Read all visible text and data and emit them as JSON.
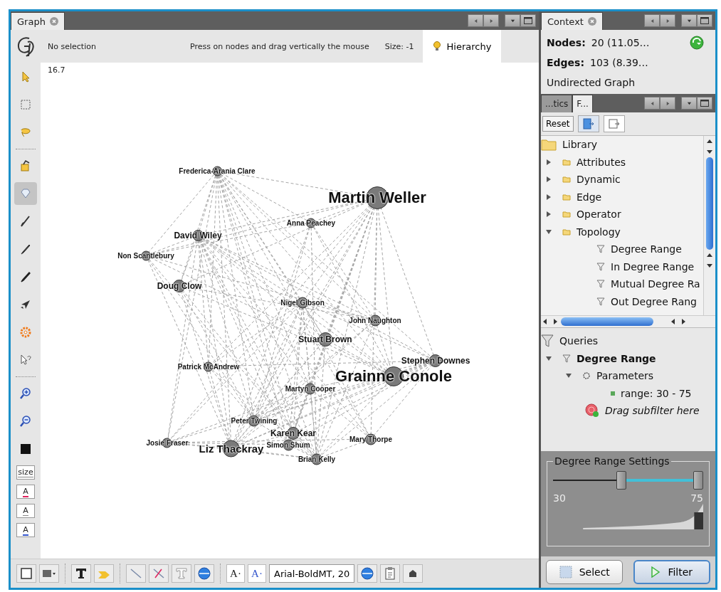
{
  "graph_tab": {
    "title": "Graph"
  },
  "graph_header": {
    "selection": "No selection",
    "hint": "Press on nodes and drag vertically the mouse",
    "size": "Size: -1",
    "hierarchy": "Hierarchy"
  },
  "scale": "16.7",
  "tools": [
    {
      "kind": "pointer",
      "selected": false
    },
    {
      "kind": "rect_select",
      "selected": false
    },
    {
      "kind": "lasso",
      "selected": false
    },
    {
      "kind": "separator"
    },
    {
      "kind": "painter",
      "selected": false
    },
    {
      "kind": "diamond",
      "selected": true
    },
    {
      "kind": "brush",
      "selected": false
    },
    {
      "kind": "pencil",
      "selected": false
    },
    {
      "kind": "pen",
      "selected": false
    },
    {
      "kind": "plane",
      "selected": false
    },
    {
      "kind": "gear",
      "selected": false
    },
    {
      "kind": "help",
      "selected": false
    },
    {
      "kind": "separator"
    },
    {
      "kind": "zoom_in",
      "selected": false
    },
    {
      "kind": "zoom_out",
      "selected": false
    },
    {
      "kind": "black_square",
      "selected": false
    },
    {
      "kind": "text",
      "label": "size",
      "selected": false
    },
    {
      "kind": "text",
      "label": "A",
      "color": "#e0245e",
      "selected": false
    },
    {
      "kind": "text",
      "label": "A",
      "selected": false
    },
    {
      "kind": "text",
      "label": "A",
      "color": "#3355cc",
      "selected": false
    }
  ],
  "nodes": [
    {
      "label": "Frederica-Arania Clare",
      "kind": "small"
    },
    {
      "label": "Martin Weller",
      "kind": "large"
    },
    {
      "label": "Anna Peachey",
      "kind": "small"
    },
    {
      "label": "David Wiley",
      "kind": "medium"
    },
    {
      "label": "Non Scantlebury",
      "kind": "small"
    },
    {
      "label": "Doug Clow",
      "kind": "medium"
    },
    {
      "label": "Nigel Gibson",
      "kind": "small"
    },
    {
      "label": "John Naughton",
      "kind": "small"
    },
    {
      "label": "Stuart Brown",
      "kind": "medium"
    },
    {
      "label": "Stephen Downes",
      "kind": "medium"
    },
    {
      "label": "Grainne Conole",
      "kind": "large"
    },
    {
      "label": "Patrick McAndrew",
      "kind": "small"
    },
    {
      "label": "Martyn Cooper",
      "kind": "small"
    },
    {
      "label": "Peter Twining",
      "kind": "small"
    },
    {
      "label": "Karen Kear",
      "kind": "medium"
    },
    {
      "label": "Josie Fraser",
      "kind": "small"
    },
    {
      "label": "Liz Thackray",
      "kind": "big"
    },
    {
      "label": "Simon Shum",
      "kind": "small"
    },
    {
      "label": "Mary Thorpe",
      "kind": "small"
    },
    {
      "label": "Brian Kelly",
      "kind": "small"
    }
  ],
  "bottom_toolbar": [
    {
      "kind": "square"
    },
    {
      "kind": "node_menu"
    },
    {
      "kind": "separator"
    },
    {
      "kind": "bold_t"
    },
    {
      "kind": "edge_arrow"
    },
    {
      "kind": "separator"
    },
    {
      "kind": "line"
    },
    {
      "kind": "color_line"
    },
    {
      "kind": "outline_t"
    },
    {
      "kind": "sphere"
    },
    {
      "kind": "separator"
    },
    {
      "kind": "text",
      "label": "A·"
    },
    {
      "kind": "text",
      "label": "A·",
      "color": "#3355cc"
    },
    {
      "kind": "font_field",
      "label": "Arial-BoldMT, 20"
    },
    {
      "kind": "sphere"
    },
    {
      "kind": "clipboard"
    },
    {
      "kind": "small_icon"
    }
  ],
  "context": {
    "tab": "Context",
    "nodes_label": "Nodes:",
    "nodes_value": "20 (11.05…",
    "edges_label": "Edges:",
    "edges_value": "103 (8.39…",
    "graph_type": "Undirected Graph"
  },
  "filter_tabs": [
    {
      "label": "...tics",
      "selected": false
    },
    {
      "label": "F...",
      "selected": true
    }
  ],
  "filter_toolbar": {
    "reset": "Reset"
  },
  "library": [
    {
      "label": "Library",
      "kind": "root",
      "children": [
        {
          "label": "Attributes",
          "kind": "folder",
          "expanded": false
        },
        {
          "label": "Dynamic",
          "kind": "folder",
          "expanded": false
        },
        {
          "label": "Edge",
          "kind": "folder",
          "expanded": false
        },
        {
          "label": "Operator",
          "kind": "folder",
          "expanded": false
        },
        {
          "label": "Topology",
          "kind": "folder",
          "expanded": true,
          "children": [
            {
              "label": "Degree Range",
              "kind": "filter"
            },
            {
              "label": "In Degree Range",
              "kind": "filter"
            },
            {
              "label": "Mutual Degree Ra",
              "kind": "filter"
            },
            {
              "label": "Out Degree Rang",
              "kind": "filter"
            }
          ]
        }
      ]
    }
  ],
  "queries": [
    {
      "label": "Queries",
      "kind": "root",
      "children": [
        {
          "label": "Degree Range",
          "kind": "query",
          "expanded": true,
          "children": [
            {
              "label": "Parameters",
              "kind": "parameters",
              "expanded": true,
              "children": [
                {
                  "label": "range: 30 - 75",
                  "kind": "parameter"
                }
              ]
            },
            {
              "label": "Drag subfilter here",
              "kind": "drop_target"
            }
          ]
        }
      ]
    }
  ],
  "settings": {
    "title": "Degree Range Settings",
    "thumbs": [
      {
        "level": 0.45
      },
      {
        "level": 1
      }
    ],
    "min": "30",
    "max": "75"
  },
  "buttons": [
    {
      "label": "Select",
      "kind": "select"
    },
    {
      "label": "Filter",
      "kind": "filter"
    }
  ]
}
